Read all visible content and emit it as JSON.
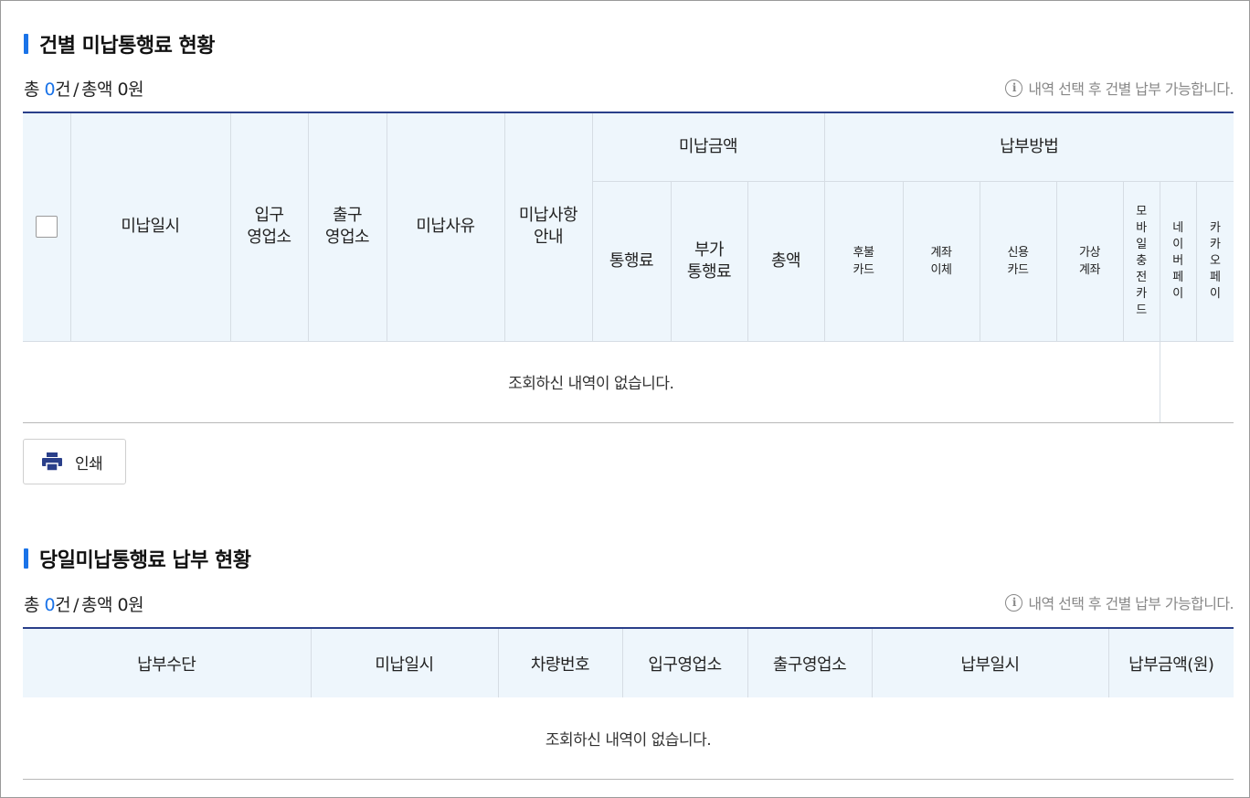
{
  "section1": {
    "title": "건별 미납통행료 현황",
    "summary": {
      "total_prefix": "총 ",
      "count": "0",
      "count_unit": "건",
      "separator": "/",
      "amount_label": "총액 0원"
    },
    "notice": "내역 선택 후 건별 납부 가능합니다.",
    "columns": {
      "unpaid_datetime": "미납일시",
      "entry_office": [
        "입구",
        "영업소"
      ],
      "exit_office": [
        "출구",
        "영업소"
      ],
      "unpaid_reason": "미납사유",
      "unpaid_guide": [
        "미납사항",
        "안내"
      ],
      "unpaid_amount_group": "미납금액",
      "toll": "통행료",
      "extra_toll": [
        "부가",
        "통행료"
      ],
      "total": "총액",
      "payment_method_group": "납부방법",
      "postpaid_card": [
        "후불",
        "카드"
      ],
      "account_transfer": [
        "계좌",
        "이체"
      ],
      "credit_card": [
        "신용",
        "카드"
      ],
      "virtual_account": [
        "가상",
        "계좌"
      ],
      "mobile_charge_card": [
        "모",
        "바",
        "일",
        "충",
        "전",
        "카",
        "드"
      ],
      "naver_pay": [
        "네",
        "이",
        "버",
        "페",
        "이"
      ],
      "kakao_pay": [
        "카",
        "카",
        "오",
        "페",
        "이"
      ]
    },
    "empty_message": "조회하신 내역이 없습니다."
  },
  "print_button": {
    "label": "인쇄",
    "icon": "printer-icon",
    "icon_color": "#2a3f8a"
  },
  "section2": {
    "title": "당일미납통행료 납부 현황",
    "summary": {
      "total_prefix": "총 ",
      "count": "0",
      "count_unit": "건",
      "separator": "/",
      "amount_label": "총액 0원"
    },
    "notice": "내역 선택 후 건별 납부 가능합니다.",
    "columns": [
      "납부수단",
      "미납일시",
      "차량번호",
      "입구영업소",
      "출구영업소",
      "납부일시",
      "납부금액(원)"
    ],
    "empty_message": "조회하신 내역이 없습니다."
  },
  "colors": {
    "accent": "#1a73e8",
    "header_bg": "#eef6fc",
    "table_top_border": "#2a3f8a"
  }
}
